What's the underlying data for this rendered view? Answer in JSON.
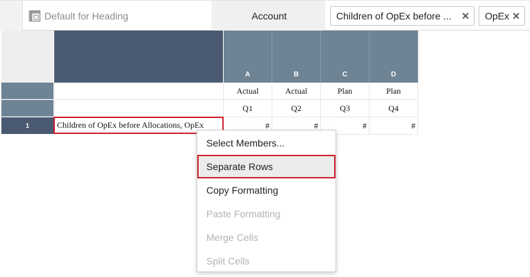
{
  "header": {
    "default_heading": "Default for Heading",
    "default_heading_icon": "layout-icon",
    "account_label": "Account",
    "chips": [
      {
        "label": "Children of OpEx before ...",
        "remove_icon": "close-icon"
      },
      {
        "label": "OpEx",
        "remove_icon": "close-icon"
      }
    ]
  },
  "grid": {
    "columns": [
      {
        "letter": "A",
        "scenario": "Actual",
        "period": "Q1"
      },
      {
        "letter": "B",
        "scenario": "Actual",
        "period": "Q2"
      },
      {
        "letter": "C",
        "scenario": "Plan",
        "period": "Q3"
      },
      {
        "letter": "D",
        "scenario": "Plan",
        "period": "Q4"
      }
    ],
    "rows": [
      {
        "number": "1",
        "member": "Children of OpEx before Allocations, OpEx",
        "values": [
          "#",
          "#",
          "#",
          "#"
        ]
      }
    ]
  },
  "context_menu": {
    "items": [
      {
        "label": "Select Members...",
        "enabled": true
      },
      {
        "label": "Separate Rows",
        "enabled": true,
        "highlighted": true
      },
      {
        "label": "Copy Formatting",
        "enabled": true
      },
      {
        "label": "Paste Formatting",
        "enabled": false
      },
      {
        "label": "Merge Cells",
        "enabled": false
      },
      {
        "label": "Split Cells",
        "enabled": false
      }
    ]
  },
  "colors": {
    "header_dark": "#4a5a73",
    "column_header": "#6e8394",
    "highlight_red": "#d0222e"
  }
}
